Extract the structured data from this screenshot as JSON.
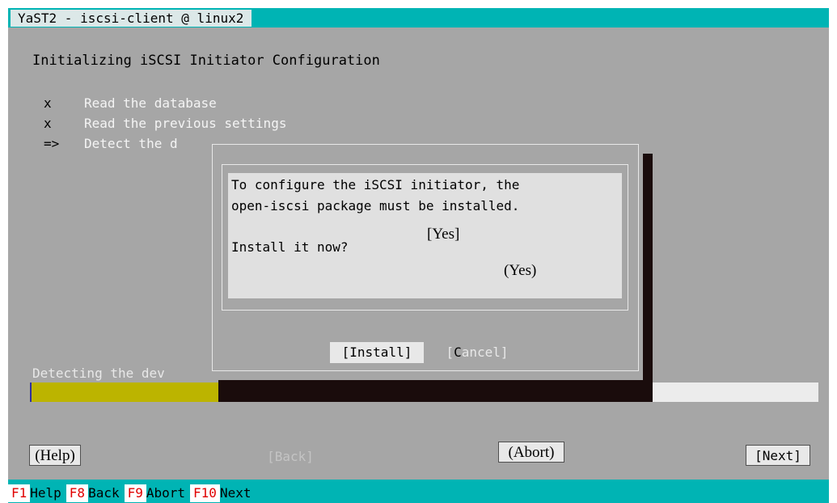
{
  "window": {
    "title": "YaST2 - iscsi-client @ linux2"
  },
  "heading": "Initializing iSCSI Initiator Configuration",
  "steps": [
    {
      "mark": "x",
      "text": "Read the database"
    },
    {
      "mark": "x",
      "text": "Read the previous settings"
    },
    {
      "mark": "=>",
      "text": "Detect the d"
    }
  ],
  "dialog": {
    "message_line1": "To configure the iSCSI initiator, the",
    "message_line2": "open-iscsi package must be installed.",
    "question": "Install it now?",
    "yes_bracket": "[Yes]",
    "yes_paren": "(Yes)",
    "install_label": "[Install]",
    "cancel_pre": "[",
    "cancel_hot": "C",
    "cancel_post": "ancel]"
  },
  "progress": {
    "label": "Detecting the dev",
    "fraction": 0.24
  },
  "buttons": {
    "help": "(Help)",
    "back": "[Back]",
    "abort": "(Abort)",
    "next": "[Next]"
  },
  "fkeys": [
    {
      "key": "F1",
      "label": "Help"
    },
    {
      "key": "F8",
      "label": "Back"
    },
    {
      "key": "F9",
      "label": "Abort"
    },
    {
      "key": "F10",
      "label": "Next"
    }
  ],
  "colors": {
    "title_bar": "#00b4b4",
    "terminal_bg": "#a6a6a6",
    "progress_fill": "#bcb400",
    "shadow": "#1a0c0c",
    "fkey_text": "#e00000"
  }
}
